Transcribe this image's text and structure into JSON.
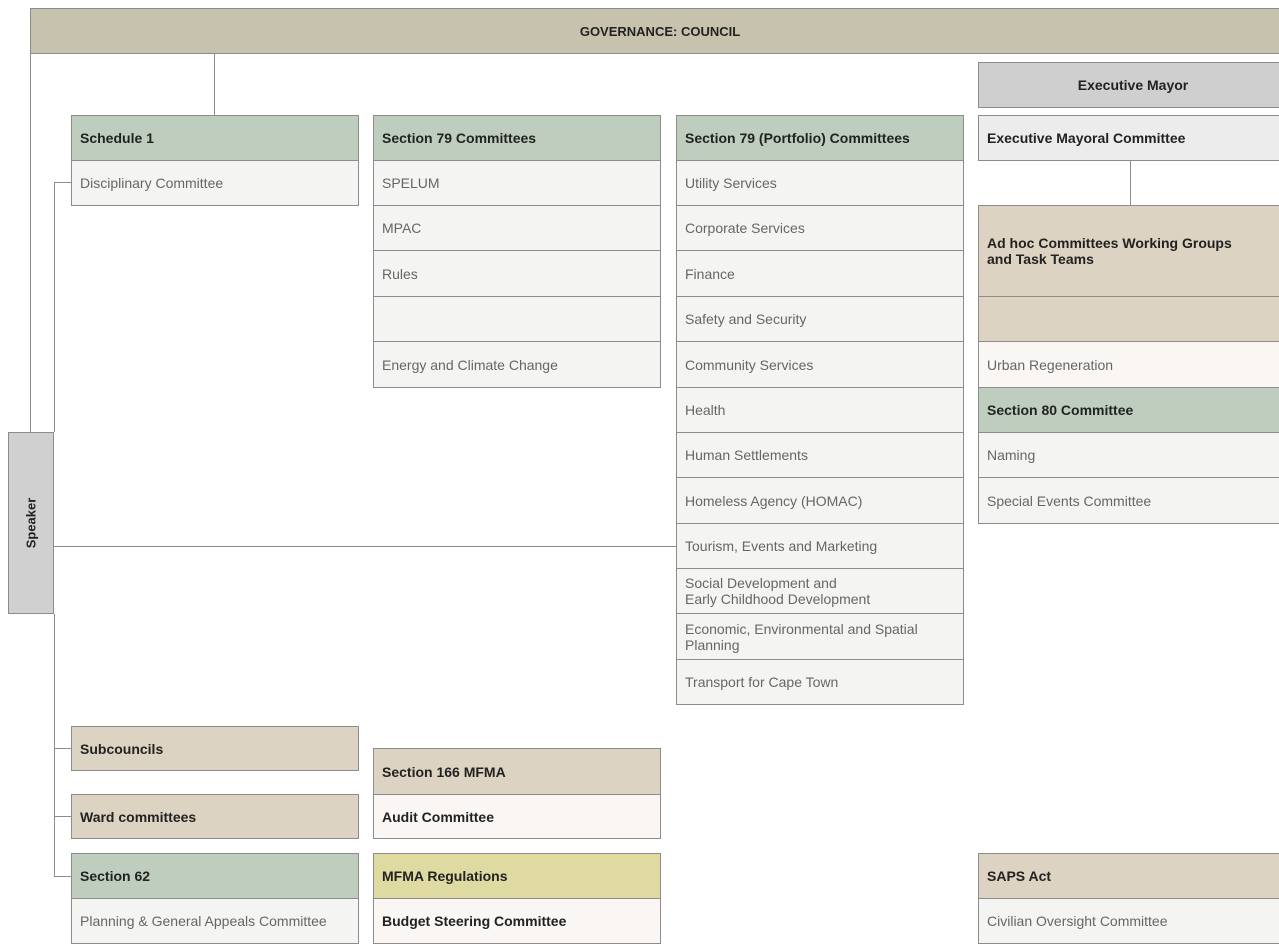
{
  "council": "GOVERNANCE: COUNCIL",
  "speaker": "Speaker",
  "schedule1": {
    "header": "Schedule 1",
    "items": [
      "Disciplinary Committee"
    ]
  },
  "section79": {
    "header": "Section 79 Committees",
    "items": [
      "SPELUM",
      "MPAC",
      "Rules",
      "",
      "Energy and Climate Change"
    ]
  },
  "portfolio": {
    "header": "Section 79 (Portfolio) Committees",
    "items": [
      "Utility Services",
      "Corporate Services",
      "Finance",
      "Safety and Security",
      "Community Services",
      "Health",
      "Human Settlements",
      "Homeless Agency (HOMAC)",
      "Tourism, Events and Marketing",
      "Social Development and\nEarly Childhood Development",
      "Economic, Environmental and Spatial\nPlanning",
      "Transport for Cape Town"
    ]
  },
  "mayor": {
    "executive_mayor": "Executive Mayor",
    "mayoral_committee": "Executive Mayoral Committee",
    "adhoc": "Ad hoc Committees Working Groups\nand Task Teams",
    "adhoc_blank": "",
    "urban": "Urban Regeneration",
    "section80": "Section 80 Committee",
    "naming": "Naming",
    "special_events": "Special Events Committee"
  },
  "subcouncils": "Subcouncils",
  "ward": "Ward committees",
  "section166": {
    "header": "Section 166 MFMA",
    "item": "Audit Committee"
  },
  "section62": {
    "header": "Section 62",
    "item": "Planning & General Appeals Committee"
  },
  "mfma_reg": {
    "header": "MFMA Regulations",
    "item": "Budget Steering Committee"
  },
  "saps": {
    "header": "SAPS Act",
    "item": "Civilian Oversight Committee"
  }
}
